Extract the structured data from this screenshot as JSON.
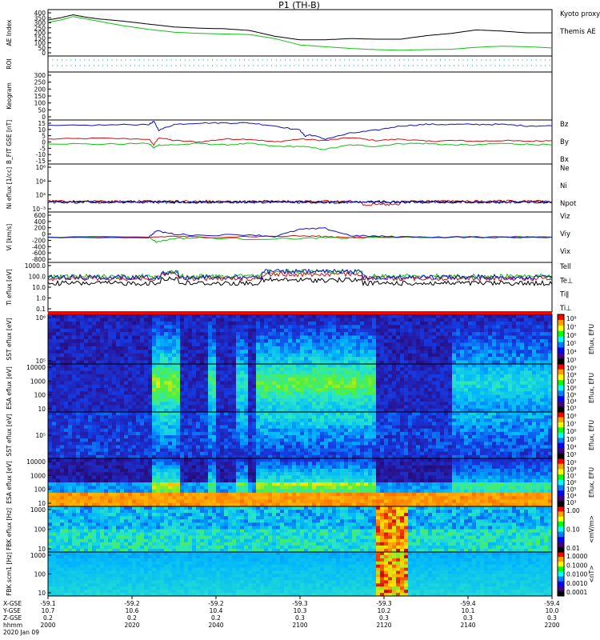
{
  "title": "P1  (TH-B)",
  "colors": {
    "bg": "#ffffff",
    "axis": "#000000",
    "red": "#d01010",
    "green": "#10c010",
    "blue": "#1010c8",
    "black": "#000000",
    "cyan": "#10a0d0"
  },
  "xaxis": {
    "rows": [
      {
        "label": "X-GSE",
        "values": [
          "-59.1",
          "-59.2",
          "-59.2",
          "-59.3",
          "-59.3",
          "-59.4",
          "-59.4"
        ]
      },
      {
        "label": "Y-GSE",
        "values": [
          "10.7",
          "10.6",
          "10.4",
          "10.3",
          "10.2",
          "10.1",
          "10.0"
        ]
      },
      {
        "label": "Z-GSE",
        "values": [
          "0.2",
          "0.2",
          "0.2",
          "0.3",
          "0.3",
          "0.3",
          "0.3"
        ]
      },
      {
        "label": "hhmm",
        "values": [
          "2000",
          "2020",
          "2040",
          "2100",
          "2120",
          "2140",
          "2200"
        ]
      }
    ],
    "date": "2020 Jan 09"
  },
  "chart_data": [
    {
      "id": "ae",
      "type": "line",
      "ylabel": "AE Index",
      "ylim": [
        0,
        400
      ],
      "yticks": [
        "400",
        "350",
        "300",
        "250",
        "200",
        "150",
        "100",
        "50",
        "0"
      ],
      "x_range": [
        2000,
        2200
      ],
      "series": [
        {
          "name": "Kyoto proxy AE",
          "color": "green",
          "x": [
            2000,
            2005,
            2010,
            2015,
            2020,
            2030,
            2040,
            2050,
            2060,
            2070,
            2080,
            2090,
            2100,
            2110,
            2120,
            2130,
            2140,
            2150,
            2160,
            2170,
            2180,
            2190,
            2200
          ],
          "y": [
            290,
            310,
            340,
            320,
            300,
            260,
            230,
            205,
            195,
            190,
            185,
            150,
            95,
            80,
            65,
            55,
            50,
            55,
            58,
            75,
            85,
            80,
            70
          ]
        },
        {
          "name": "Themis AE",
          "color": "black",
          "x": [
            2000,
            2005,
            2010,
            2015,
            2020,
            2030,
            2040,
            2050,
            2060,
            2070,
            2080,
            2090,
            2100,
            2110,
            2120,
            2130,
            2140,
            2150,
            2160,
            2170,
            2180,
            2190,
            2200
          ],
          "y": [
            310,
            330,
            355,
            335,
            320,
            300,
            275,
            250,
            240,
            235,
            220,
            170,
            140,
            140,
            150,
            145,
            145,
            175,
            195,
            225,
            215,
            200,
            200
          ]
        }
      ]
    },
    {
      "id": "roi",
      "type": "line",
      "ylabel": "ROI",
      "yticks": []
    },
    {
      "id": "keogram",
      "type": "line",
      "ylabel": "Keogram",
      "ylim": [
        0,
        300
      ],
      "yticks": [
        "300",
        "250",
        "200",
        "150",
        "100",
        "50",
        "0"
      ]
    },
    {
      "id": "bfield",
      "type": "line",
      "ylabel": "B_FIT GSE [nT]",
      "ylim": [
        -15,
        15
      ],
      "yticks": [
        "15",
        "10",
        "5",
        "0",
        "-5",
        "-10",
        "-15"
      ],
      "series": [
        {
          "name": "Bz",
          "color": "red",
          "x": [
            2000,
            2020,
            2040,
            2042,
            2044,
            2050,
            2060,
            2070,
            2080,
            2090,
            2100,
            2110,
            2120,
            2130,
            2140,
            2150,
            2160,
            2170,
            2180,
            2190,
            2200
          ],
          "y": [
            2,
            2.5,
            2,
            -2,
            3,
            1,
            0,
            2,
            2,
            0,
            2,
            1,
            3,
            1,
            2,
            0.5,
            1,
            0.5,
            1,
            0.5,
            1
          ]
        },
        {
          "name": "By",
          "color": "green",
          "x": [
            2000,
            2020,
            2040,
            2042,
            2044,
            2050,
            2060,
            2070,
            2080,
            2090,
            2100,
            2110,
            2120,
            2130,
            2140,
            2150,
            2160,
            2170,
            2180,
            2190,
            2200
          ],
          "y": [
            -1,
            -1.5,
            -1,
            -4,
            -2,
            -2,
            -1,
            -2,
            -1,
            -3,
            -3,
            -5,
            -2,
            -3,
            -1,
            -1,
            -2,
            -2,
            -1,
            -1.5,
            -2
          ]
        },
        {
          "name": "Bx",
          "color": "blue",
          "x": [
            2000,
            2020,
            2040,
            2042,
            2044,
            2050,
            2060,
            2070,
            2080,
            2090,
            2100,
            2102,
            2104,
            2110,
            2120,
            2130,
            2140,
            2150,
            2160,
            2170,
            2180,
            2190,
            2200
          ],
          "y": [
            11,
            11.5,
            12,
            14,
            8,
            12,
            13,
            13,
            13,
            11,
            8,
            4,
            5,
            2,
            6,
            8,
            11,
            12,
            12,
            12,
            12,
            11,
            11
          ]
        }
      ]
    },
    {
      "id": "density",
      "type": "line",
      "ylabel": "Ni eflux [1/cc]",
      "ylim": [
        -3,
        8
      ],
      "yticks": [
        "10⁸",
        "10⁴",
        "10³",
        "10⁻³"
      ],
      "series": [
        {
          "name": "Ne",
          "color": "red"
        },
        {
          "name": "Ni",
          "color": "black"
        },
        {
          "name": "Npot",
          "color": "blue"
        }
      ]
    },
    {
      "id": "velocity",
      "type": "line",
      "ylabel": "Vi [km/s]",
      "ylim": [
        -800,
        800
      ],
      "yticks": [
        "600",
        "400",
        "200",
        "0",
        "-200",
        "-400",
        "-600",
        "-800"
      ],
      "series": [
        {
          "name": "Viz",
          "color": "red",
          "x": [
            2000,
            2040,
            2050,
            2060,
            2080,
            2100,
            2110,
            2120,
            2140,
            2160,
            2180,
            2200
          ],
          "y": [
            0,
            0,
            30,
            0,
            20,
            40,
            20,
            0,
            0,
            10,
            0,
            0
          ]
        },
        {
          "name": "Viy",
          "color": "green",
          "x": [
            2000,
            2040,
            2043,
            2050,
            2060,
            2080,
            2100,
            2110,
            2120,
            2140,
            2160,
            2180,
            2200
          ],
          "y": [
            0,
            0,
            -150,
            -40,
            -20,
            -60,
            -40,
            -20,
            -30,
            0,
            0,
            -10,
            0
          ]
        },
        {
          "name": "Vix",
          "color": "blue",
          "x": [
            2000,
            2040,
            2043,
            2050,
            2060,
            2080,
            2090,
            2100,
            2110,
            2120,
            2130,
            2140,
            2160,
            2180,
            2200
          ],
          "y": [
            0,
            0,
            200,
            100,
            60,
            80,
            20,
            250,
            280,
            50,
            30,
            10,
            0,
            0,
            0
          ]
        }
      ]
    },
    {
      "id": "temperature",
      "type": "line",
      "ylabel": "Ti eflux [eV]",
      "ylim": [
        0.1,
        10000
      ],
      "yticks": [
        "1000.0",
        "100.0",
        "10.0",
        "1.0",
        "0.1"
      ],
      "series": [
        {
          "name": "Tell",
          "color": "black"
        },
        {
          "name": "Te⊥",
          "color": "red"
        },
        {
          "name": "Ti∥",
          "color": "green"
        },
        {
          "name": "Ti⊥",
          "color": "blue"
        }
      ]
    },
    {
      "id": "sst_e",
      "type": "heatmap",
      "ylabel": "SST eflux [eV]",
      "yticks": [
        "10⁶",
        "10⁵"
      ],
      "colorbar": {
        "label": "Eflux, EFU",
        "ticks": [
          "10⁸",
          "10⁷",
          "10⁶",
          "10⁵",
          "10⁴",
          "10³"
        ]
      }
    },
    {
      "id": "esa_e",
      "type": "heatmap",
      "ylabel": "ESA eflux [eV]",
      "yticks": [
        "10000",
        "1000",
        "100",
        "10"
      ],
      "colorbar": {
        "label": "Eflux, EFU",
        "ticks": [
          "10⁹",
          "10⁸",
          "10⁷",
          "10⁶",
          "10⁵",
          "10⁴",
          "10³"
        ]
      }
    },
    {
      "id": "sst_i",
      "type": "heatmap",
      "ylabel": "SST eflux [eV]",
      "yticks": [
        "10⁵"
      ],
      "colorbar": {
        "label": "Eflux, EFU",
        "ticks": [
          "10⁸",
          "10⁷",
          "10⁶",
          "10⁵",
          "10⁴",
          "10³"
        ]
      }
    },
    {
      "id": "esa_i",
      "type": "heatmap",
      "ylabel": "ESA eflux [eV]",
      "yticks": [
        "10000",
        "1000",
        "100",
        "10"
      ],
      "colorbar": {
        "label": "Eflux, EFU",
        "ticks": [
          "10⁹",
          "10⁸",
          "10⁷",
          "10⁶",
          "10⁵",
          "10⁴",
          "10³"
        ]
      }
    },
    {
      "id": "fbk_e",
      "type": "heatmap",
      "ylabel": "FBK eflux [Hz]",
      "yticks": [
        "1000",
        "100",
        "10"
      ],
      "colorbar": {
        "label": "<mV/m>",
        "ticks": [
          "1.00",
          "0.10",
          "0.01"
        ]
      }
    },
    {
      "id": "fbk_b",
      "type": "heatmap",
      "ylabel": "FBK scm1 [Hz]",
      "yticks": [
        "1000",
        "100",
        "10"
      ],
      "colorbar": {
        "label": "<nT>",
        "ticks": [
          "1.0000",
          "0.1000",
          "0.0100",
          "0.0010",
          "0.0001"
        ]
      }
    }
  ]
}
